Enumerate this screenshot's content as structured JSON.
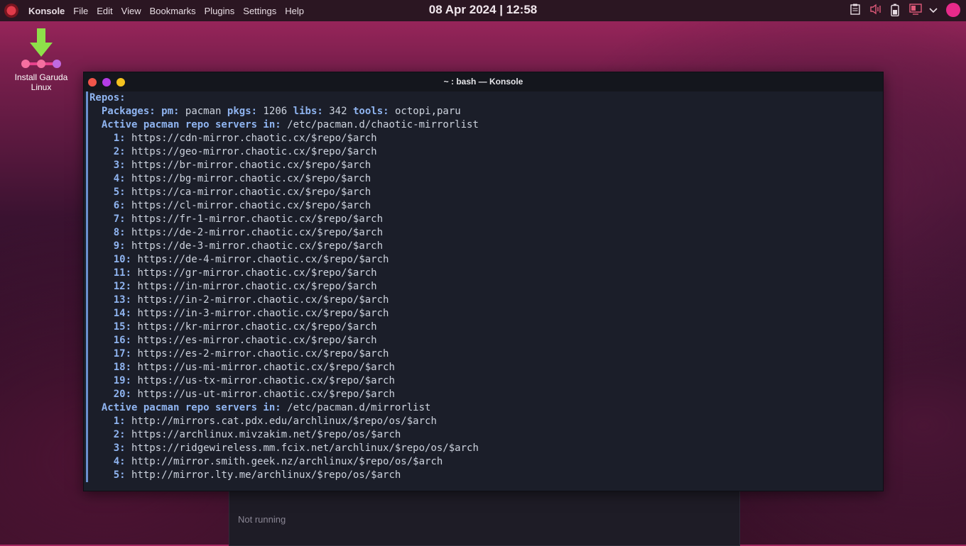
{
  "topbar": {
    "app_name": "Konsole",
    "menu": [
      "File",
      "Edit",
      "View",
      "Bookmarks",
      "Plugins",
      "Settings",
      "Help"
    ],
    "clock": "08 Apr 2024 | 12:58",
    "tray_icons": [
      "clipboard-icon",
      "volume-icon",
      "battery-icon",
      "network-icon",
      "chevron-down-icon",
      "avatar"
    ]
  },
  "desktop": {
    "icon_label": "Install Garuda Linux"
  },
  "konsole": {
    "title": "~ : bash — Konsole",
    "repos_label": "Repos:",
    "packages_line": {
      "label": "Packages:",
      "pm_label": "pm:",
      "pm": "pacman",
      "pkgs_label": "pkgs:",
      "pkgs": "1206",
      "libs_label": "libs:",
      "libs": "342",
      "tools_label": "tools:",
      "tools": "octopi,paru"
    },
    "servers_label": "Active pacman repo servers in:",
    "mirrorlists": [
      {
        "path": "/etc/pacman.d/chaotic-mirrorlist",
        "servers": [
          "https://cdn-mirror.chaotic.cx/$repo/$arch",
          "https://geo-mirror.chaotic.cx/$repo/$arch",
          "https://br-mirror.chaotic.cx/$repo/$arch",
          "https://bg-mirror.chaotic.cx/$repo/$arch",
          "https://ca-mirror.chaotic.cx/$repo/$arch",
          "https://cl-mirror.chaotic.cx/$repo/$arch",
          "https://fr-1-mirror.chaotic.cx/$repo/$arch",
          "https://de-2-mirror.chaotic.cx/$repo/$arch",
          "https://de-3-mirror.chaotic.cx/$repo/$arch",
          "https://de-4-mirror.chaotic.cx/$repo/$arch",
          "https://gr-mirror.chaotic.cx/$repo/$arch",
          "https://in-mirror.chaotic.cx/$repo/$arch",
          "https://in-2-mirror.chaotic.cx/$repo/$arch",
          "https://in-3-mirror.chaotic.cx/$repo/$arch",
          "https://kr-mirror.chaotic.cx/$repo/$arch",
          "https://es-mirror.chaotic.cx/$repo/$arch",
          "https://es-2-mirror.chaotic.cx/$repo/$arch",
          "https://us-mi-mirror.chaotic.cx/$repo/$arch",
          "https://us-tx-mirror.chaotic.cx/$repo/$arch",
          "https://us-ut-mirror.chaotic.cx/$repo/$arch"
        ]
      },
      {
        "path": "/etc/pacman.d/mirrorlist",
        "servers": [
          "http://mirrors.cat.pdx.edu/archlinux/$repo/os/$arch",
          "https://archlinux.mivzakim.net/$repo/os/$arch",
          "https://ridgewireless.mm.fcix.net/archlinux/$repo/os/$arch",
          "http://mirror.smith.geek.nz/archlinux/$repo/os/$arch",
          "http://mirror.lty.me/archlinux/$repo/os/$arch"
        ]
      }
    ]
  },
  "background_window": {
    "status": "Not running"
  }
}
